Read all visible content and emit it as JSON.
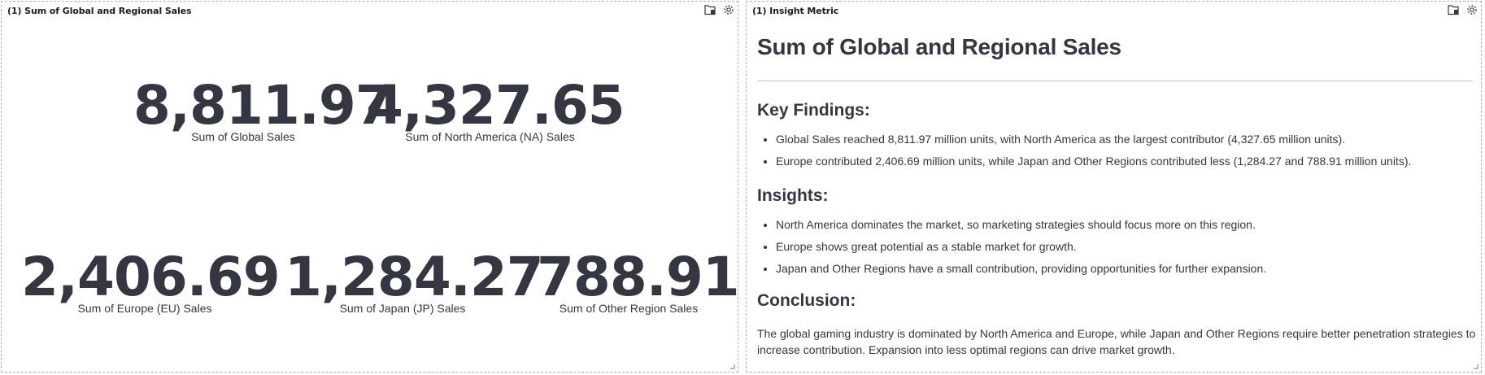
{
  "left_panel": {
    "title": "(1) Sum of Global and Regional Sales",
    "metrics": [
      {
        "value": "8,811.97",
        "label": "Sum of Global Sales"
      },
      {
        "value": "4,327.65",
        "label": "Sum of North America (NA) Sales"
      },
      {
        "value": "2,406.69",
        "label": "Sum of Europe (EU) Sales"
      },
      {
        "value": "1,284.27",
        "label": "Sum of Japan (JP) Sales"
      },
      {
        "value": "788.91",
        "label": "Sum of Other Region Sales"
      }
    ]
  },
  "right_panel": {
    "title": "(1) Insight Metric",
    "heading": "Sum of Global and Regional Sales",
    "key_findings": {
      "heading": "Key Findings:",
      "items": [
        "Global Sales reached 8,811.97 million units, with North America as the largest contributor (4,327.65 million units).",
        "Europe contributed 2,406.69 million units, while Japan and Other Regions contributed less (1,284.27 and 788.91 million units)."
      ]
    },
    "insights": {
      "heading": "Insights:",
      "items": [
        "North America dominates the market, so marketing strategies should focus more on this region.",
        "Europe shows great potential as a stable market for growth.",
        "Japan and Other Regions have a small contribution, providing opportunities for further expansion."
      ]
    },
    "conclusion": {
      "heading": "Conclusion:",
      "text": "The global gaming industry is dominated by North America and Europe, while Japan and Other Regions require better penetration strategies to increase contribution. Expansion into less optimal regions can drive market growth."
    }
  },
  "icons": {
    "export": "export-icon",
    "settings": "gear-icon",
    "resize": "resize-handle-icon"
  }
}
